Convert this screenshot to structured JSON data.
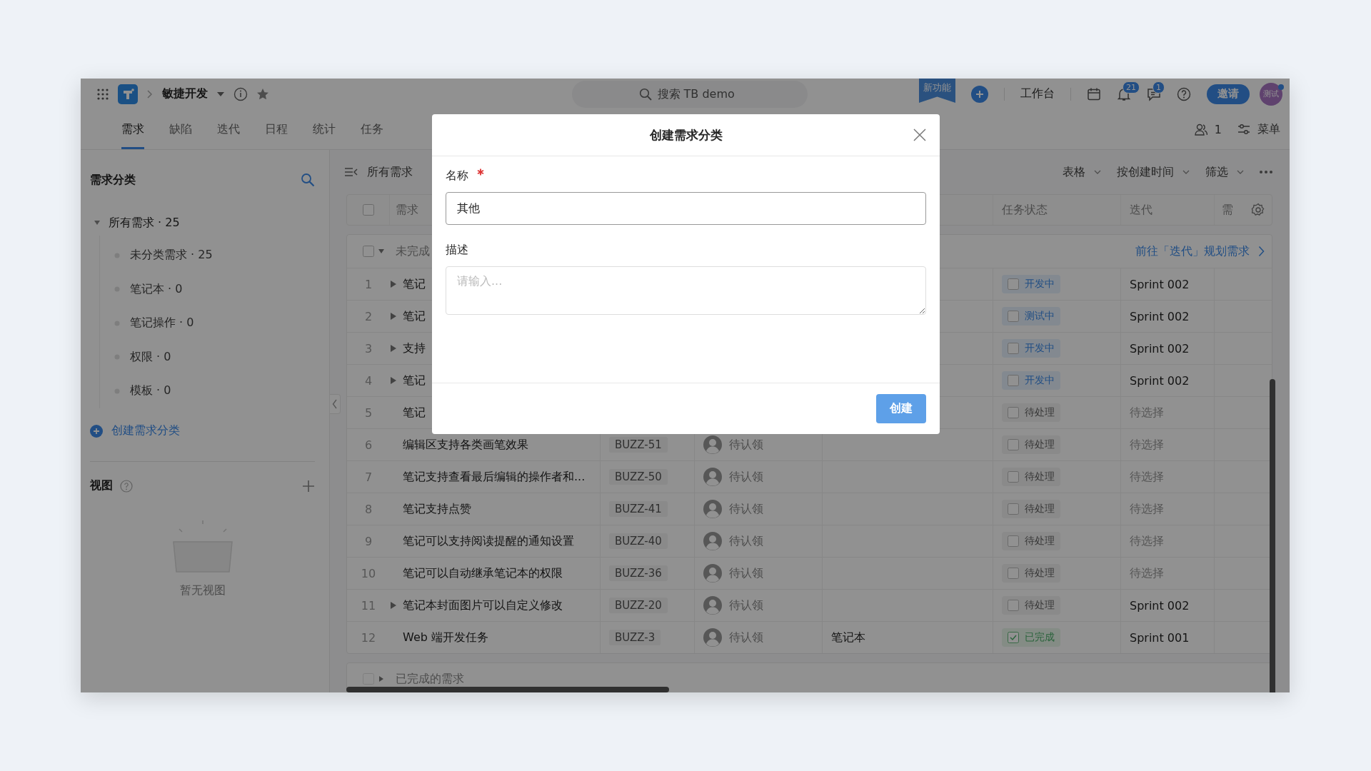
{
  "top_bar": {
    "project": "敏捷开发",
    "search": {
      "placeholder": "搜索 TB demo"
    },
    "new_feature_badge": "新功能",
    "workbench": "工作台",
    "notifications_count": "21",
    "messages_count": "1",
    "invite_button": "邀请",
    "avatar": "测试"
  },
  "tabs": [
    {
      "label": "需求",
      "selected": true
    },
    {
      "label": "缺陷",
      "selected": false
    },
    {
      "label": "迭代",
      "selected": false
    },
    {
      "label": "日程",
      "selected": false
    },
    {
      "label": "统计",
      "selected": false
    },
    {
      "label": "任务",
      "selected": false
    }
  ],
  "tab_actions": {
    "members": "1",
    "menu": "菜单"
  },
  "sidebar": {
    "title": "需求分类",
    "tree": [
      {
        "label": "所有需求 · 25",
        "expanded": true,
        "children": [
          {
            "label": "未分类需求 · 25"
          },
          {
            "label": "笔记本 · 0"
          },
          {
            "label": "笔记操作 · 0"
          },
          {
            "label": "权限 · 0"
          },
          {
            "label": "模板 · 0"
          }
        ]
      }
    ],
    "create_link": "创建需求分类",
    "views": {
      "title": "视图",
      "empty_text": "暂无视图"
    }
  },
  "toolbar": {
    "title": "所有需求",
    "actions": [
      {
        "label": "表格"
      },
      {
        "label": "按创建时间"
      },
      {
        "label": "筛选"
      }
    ]
  },
  "table": {
    "select_all_checked": false,
    "columns": [
      {
        "label": "需求"
      },
      {
        "label": "任务状态"
      },
      {
        "label": "迭代"
      },
      {
        "label": "需"
      }
    ],
    "groups": [
      {
        "label": "未完成",
        "expanded": true,
        "checked": false,
        "link": "前往「迭代」规划需求",
        "rows": [
          {
            "number": "1",
            "expandable": true,
            "title": "笔记",
            "status": {
              "label": "开发中",
              "kind": "active",
              "checked": false
            },
            "iteration": "Sprint 002",
            "iteration_placeholder": false
          },
          {
            "number": "2",
            "expandable": true,
            "title": "笔记",
            "status": {
              "label": "测试中",
              "kind": "active",
              "checked": false
            },
            "iteration": "Sprint 002",
            "iteration_placeholder": false
          },
          {
            "number": "3",
            "expandable": true,
            "title": "支持",
            "status": {
              "label": "开发中",
              "kind": "active",
              "checked": false
            },
            "iteration": "Sprint 002",
            "iteration_placeholder": false
          },
          {
            "number": "4",
            "expandable": true,
            "title": "笔记",
            "status": {
              "label": "开发中",
              "kind": "active",
              "checked": false
            },
            "iteration": "Sprint 002",
            "iteration_placeholder": false
          },
          {
            "number": "5",
            "expandable": false,
            "title": "笔记",
            "status": {
              "label": "待处理",
              "kind": "pending",
              "checked": false
            },
            "iteration": "待选择",
            "iteration_placeholder": true
          },
          {
            "number": "6",
            "expandable": false,
            "title": "编辑区支持各类画笔效果",
            "id": "BUZZ-51",
            "assignee": "待认领",
            "status": {
              "label": "待处理",
              "kind": "pending",
              "checked": false
            },
            "iteration": "待选择",
            "iteration_placeholder": true
          },
          {
            "number": "7",
            "expandable": false,
            "title": "笔记支持查看最后编辑的操作者和...",
            "id": "BUZZ-50",
            "assignee": "待认领",
            "status": {
              "label": "待处理",
              "kind": "pending",
              "checked": false
            },
            "iteration": "待选择",
            "iteration_placeholder": true
          },
          {
            "number": "8",
            "expandable": false,
            "title": "笔记支持点赞",
            "id": "BUZZ-41",
            "assignee": "待认领",
            "status": {
              "label": "待处理",
              "kind": "pending",
              "checked": false
            },
            "iteration": "待选择",
            "iteration_placeholder": true
          },
          {
            "number": "9",
            "expandable": false,
            "title": "笔记可以支持阅读提醒的通知设置",
            "id": "BUZZ-40",
            "assignee": "待认领",
            "status": {
              "label": "待处理",
              "kind": "pending",
              "checked": false
            },
            "iteration": "待选择",
            "iteration_placeholder": true
          },
          {
            "number": "10",
            "expandable": false,
            "title": "笔记可以自动继承笔记本的权限",
            "id": "BUZZ-36",
            "assignee": "待认领",
            "status": {
              "label": "待处理",
              "kind": "pending",
              "checked": false
            },
            "iteration": "待选择",
            "iteration_placeholder": true
          },
          {
            "number": "11",
            "expandable": true,
            "title": "笔记本封面图片可以自定义修改",
            "id": "BUZZ-20",
            "assignee": "待认领",
            "status": {
              "label": "待处理",
              "kind": "pending",
              "checked": false
            },
            "iteration": "Sprint 002",
            "iteration_placeholder": false
          },
          {
            "number": "12",
            "expandable": false,
            "title": "Web 端开发任务",
            "id": "BUZZ-3",
            "assignee": "待认领",
            "category": "笔记本",
            "status": {
              "label": "已完成",
              "kind": "done",
              "checked": true
            },
            "iteration": "Sprint 001",
            "iteration_placeholder": false
          }
        ]
      },
      {
        "label": "已完成的需求",
        "expanded": false,
        "checked": false
      }
    ]
  },
  "dialog": {
    "title": "创建需求分类",
    "fields": [
      {
        "label": "名称",
        "required": true,
        "kind": "input",
        "value": "其他"
      },
      {
        "label": "描述",
        "required": false,
        "kind": "textarea",
        "placeholder": "请输入..."
      }
    ],
    "submit_button": "创建"
  }
}
